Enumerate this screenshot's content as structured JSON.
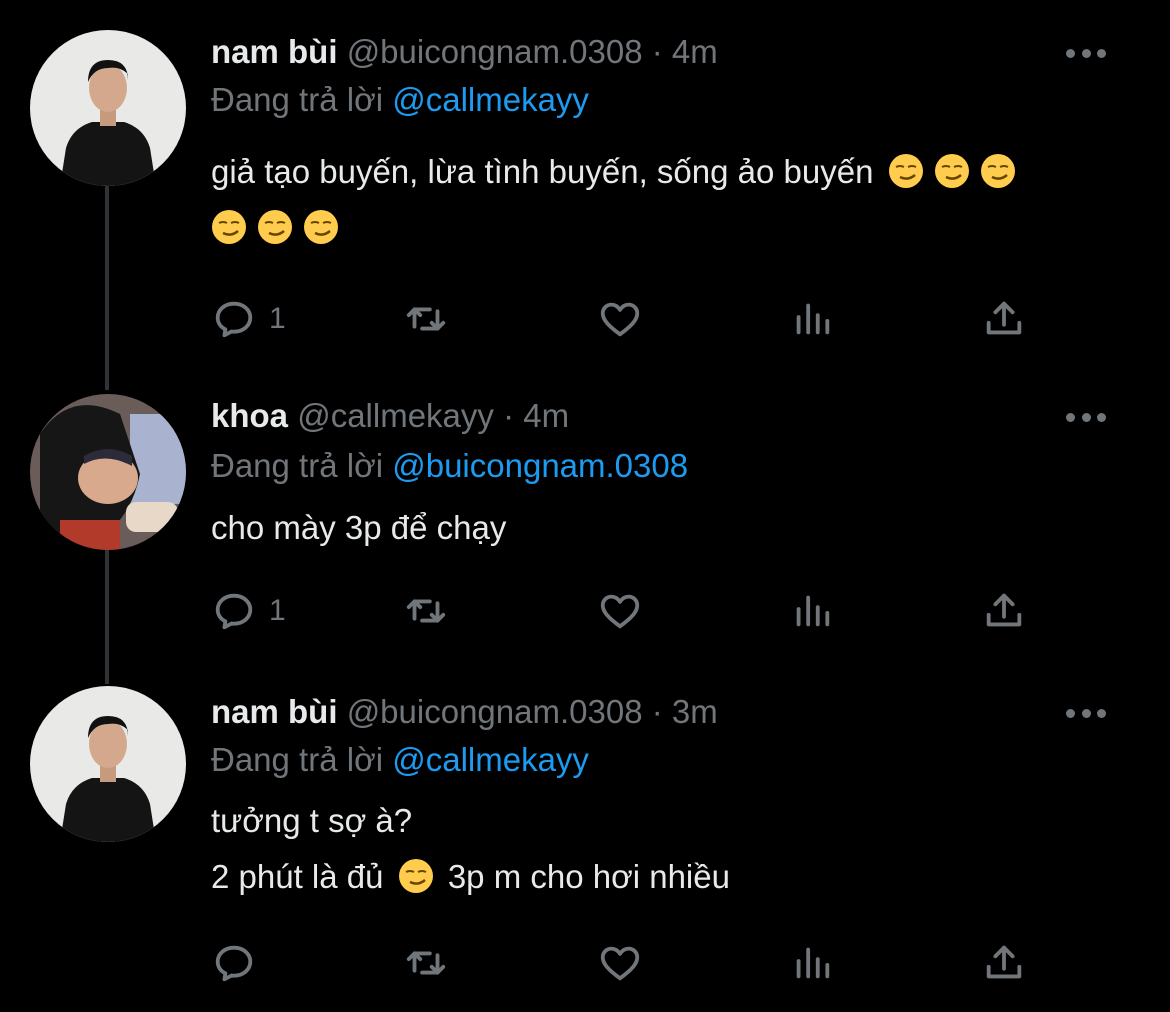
{
  "tweets": [
    {
      "name": "nam bùi",
      "handle": "@buicongnam.0308",
      "dot": "·",
      "time": "4m",
      "replying_prefix": "Đang trả lời ",
      "replying_to": "@callmekayy",
      "lines": [
        "giả tạo buyến, lừa tình buyến, sống ảo buyến"
      ],
      "reply_count": "1"
    },
    {
      "name": "khoa",
      "handle": "@callmekayy",
      "dot": "·",
      "time": "4m",
      "replying_prefix": "Đang trả lời ",
      "replying_to": "@buicongnam.0308",
      "lines": [
        "cho mày 3p để chạy"
      ],
      "reply_count": "1"
    },
    {
      "name": "nam bùi",
      "handle": "@buicongnam.0308",
      "dot": "·",
      "time": "3m",
      "replying_prefix": "Đang trả lời ",
      "replying_to": "@callmekayy",
      "line1": "tưởng t sợ à?",
      "line2a": "2 phút là đủ",
      "line2b": "3p m cho hơi nhiều",
      "reply_count": ""
    }
  ],
  "icons": {
    "reply": "speech-bubble-icon",
    "retweet": "retweet-arrows-icon",
    "like": "heart-outline-icon",
    "views": "bar-chart-icon",
    "share": "share-upload-icon",
    "more": "three-dots-icon",
    "emoji": "smirking-face-emoji"
  },
  "colors": {
    "background": "#000000",
    "text": "#e7e9ea",
    "secondary": "#71767b",
    "mention": "#1d9bf0",
    "thread_line": "#2f3336"
  }
}
